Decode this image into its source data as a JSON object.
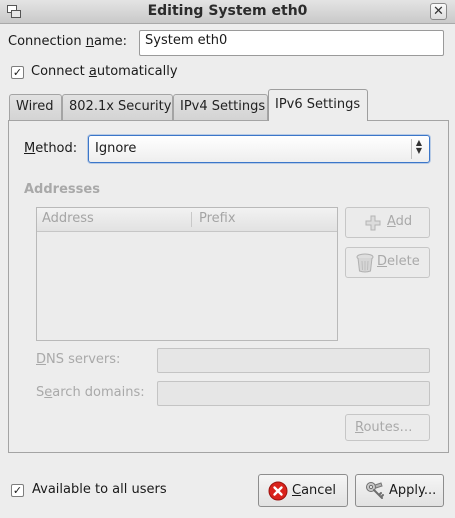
{
  "window": {
    "title": "Editing System eth0",
    "close_glyph": "✕",
    "icon": "window-menu-icon"
  },
  "connection_name": {
    "label_pre": "Connection ",
    "label_mnemonic": "n",
    "label_post": "ame:",
    "value": "System eth0"
  },
  "connect_auto": {
    "checked": true,
    "label_pre": "Connect ",
    "label_mnemonic": "a",
    "label_post": "utomatically"
  },
  "tabs": [
    {
      "label": "Wired",
      "active": false
    },
    {
      "label": "802.1x Security",
      "active": false
    },
    {
      "label": "IPv4 Settings",
      "active": false
    },
    {
      "label": "IPv6 Settings",
      "active": true
    }
  ],
  "method": {
    "label_mnemonic": "M",
    "label_post": "ethod:",
    "value": "Ignore"
  },
  "addresses": {
    "title": "Addresses",
    "columns": [
      "Address",
      "Prefix"
    ],
    "rows": [],
    "add_label_mnemonic": "A",
    "add_label_post": "dd",
    "delete_label_mnemonic": "D",
    "delete_label_post": "elete"
  },
  "dns": {
    "label_mnemonic": "D",
    "label_post": "NS servers:",
    "value": ""
  },
  "search": {
    "label_pre": "S",
    "label_mnemonic": "e",
    "label_post": "arch domains:",
    "value": ""
  },
  "routes": {
    "label_mnemonic": "R",
    "label_post": "outes…"
  },
  "available_all_users": {
    "checked": true,
    "label": "Available to all users"
  },
  "buttons": {
    "cancel_mnemonic": "C",
    "cancel_post": "ancel",
    "apply": "Apply..."
  },
  "colors": {
    "cancel_icon": "#d9231c",
    "focus_border": "#3b76c9"
  }
}
